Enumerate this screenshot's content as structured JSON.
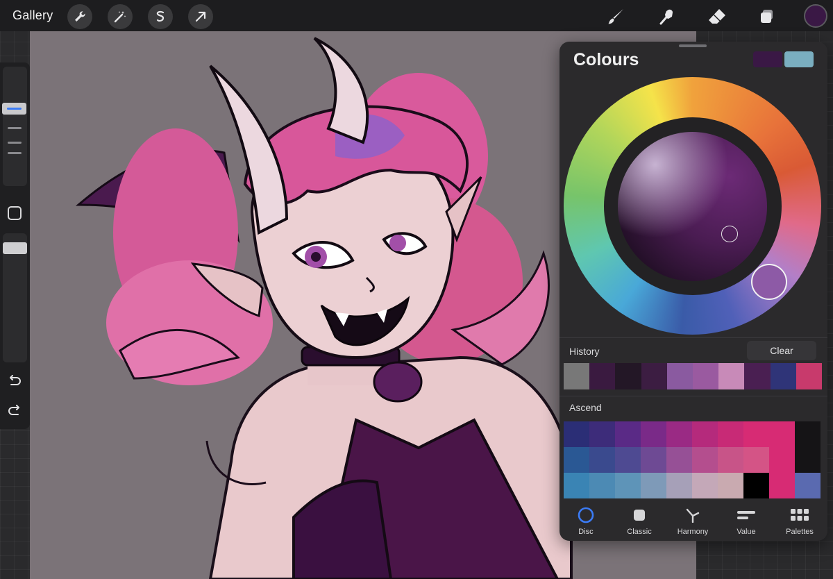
{
  "toolbar": {
    "gallery_label": "Gallery",
    "left_tools": [
      "wrench-icon",
      "magic-wand-icon",
      "selection-icon",
      "transform-arrow-icon"
    ],
    "right_tools": [
      "brush-icon",
      "smudge-icon",
      "eraser-icon",
      "layers-icon"
    ],
    "current_color": "#3a1845"
  },
  "sidebar": {
    "icons": [
      "modify-square-icon",
      "undo-icon",
      "redo-icon"
    ]
  },
  "canvas": {
    "background": "#7b7378",
    "content": "illustration"
  },
  "colours_panel": {
    "title": "Colours",
    "primary_swatch": "#3a1845",
    "secondary_swatch": "#7aaec0",
    "history_label": "History",
    "clear_label": "Clear",
    "history": [
      "#787878",
      "#3a1a40",
      "#231726",
      "#3c1d42",
      "#8a5aa0",
      "#9a5aa0",
      "#c88ab8",
      "#4a1f52",
      "#2f3478",
      "#c83a6c"
    ],
    "palette_name": "Ascend",
    "palette": [
      [
        "#2b2e76",
        "#3d2c7a",
        "#5a2a86",
        "#7a2a88",
        "#9a2a84",
        "#b52a7c",
        "#c82a76",
        "#d72b74",
        "#d72b74",
        "#151416"
      ],
      [
        "#2a5894",
        "#3a4a8e",
        "#4e4a92",
        "#6e4a94",
        "#965096",
        "#b44e8e",
        "#c85488",
        "#d45486",
        "#d72b74",
        "#151416"
      ],
      [
        "#3a84b4",
        "#4c8ab4",
        "#5e94b8",
        "#7e9ab8",
        "#a6a0b8",
        "#c4a8b8",
        "#c9aab0",
        "#000000",
        "#d72b74",
        "#5a6ab0"
      ]
    ],
    "tabs": [
      {
        "label": "Disc",
        "icon": "disc-icon",
        "active": true
      },
      {
        "label": "Classic",
        "icon": "classic-square-icon",
        "active": false
      },
      {
        "label": "Harmony",
        "icon": "harmony-icon",
        "active": false
      },
      {
        "label": "Value",
        "icon": "value-sliders-icon",
        "active": false
      },
      {
        "label": "Palettes",
        "icon": "palettes-grid-icon",
        "active": false
      }
    ],
    "accent": "#3b7bf5"
  }
}
